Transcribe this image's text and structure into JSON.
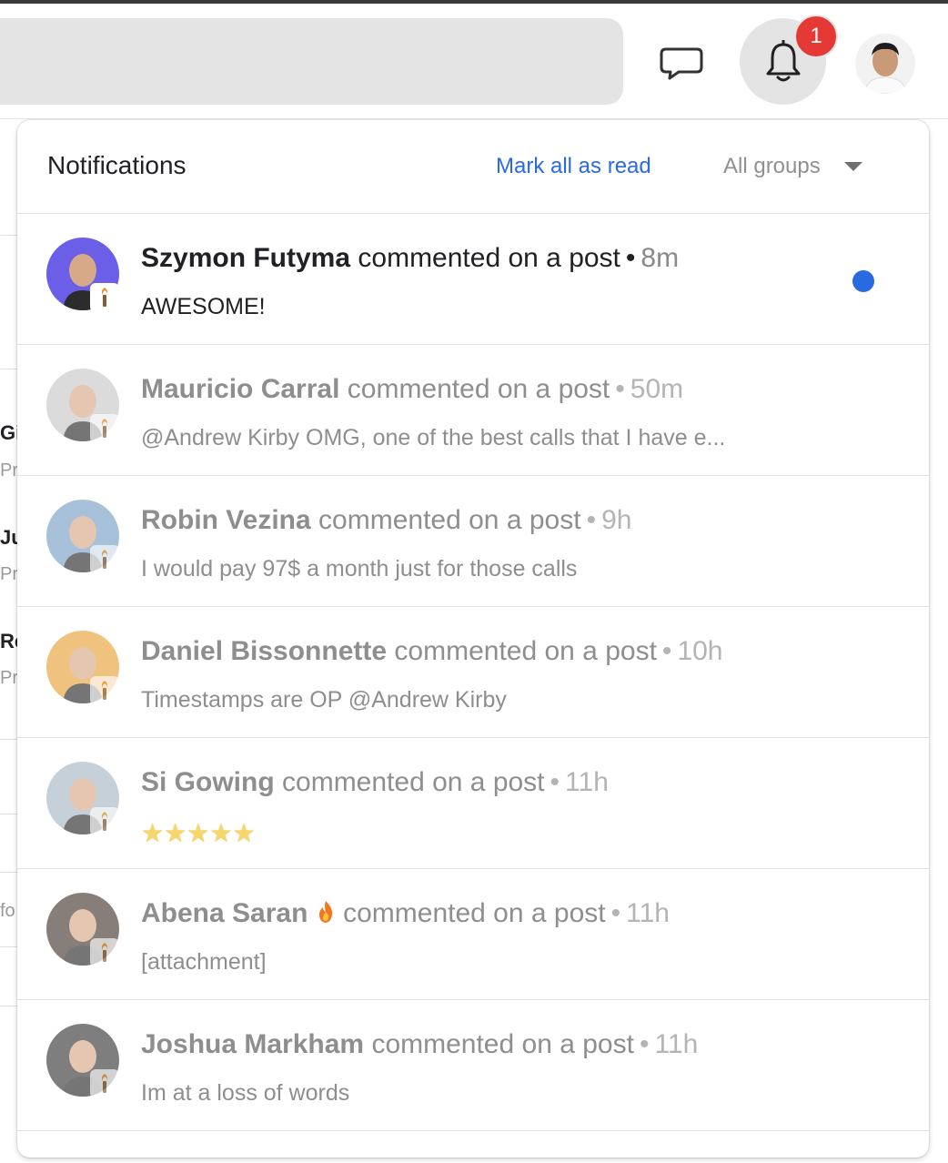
{
  "header": {
    "badge_count": "1"
  },
  "background": {
    "fragments": [
      "Gi",
      "Pr",
      "Ju",
      "Pr",
      "Re",
      "Pr",
      "fo"
    ]
  },
  "panel": {
    "title": "Notifications",
    "mark_all_label": "Mark all as read",
    "group_filter_label": "All groups"
  },
  "notifications": [
    {
      "name": "Szymon Futyma",
      "action": "commented on a post",
      "time": "8m",
      "text": "AWESOME!",
      "unread": true,
      "avatar_color": "#6b5fe8"
    },
    {
      "name": "Mauricio Carral",
      "action": "commented on a post",
      "time": "50m",
      "text": "@Andrew Kirby OMG, one of the best calls that I have e...",
      "unread": false,
      "avatar_color": "#c8c8c8"
    },
    {
      "name": "Robin Vezina",
      "action": "commented on a post",
      "time": "9h",
      "text": "I would pay 97$ a month just for those calls",
      "unread": false,
      "avatar_color": "#7aa0c8"
    },
    {
      "name": "Daniel Bissonnette",
      "action": "commented on a post",
      "time": "10h",
      "text": "Timestamps are OP @Andrew Kirby",
      "unread": false,
      "avatar_color": "#e8a33a"
    },
    {
      "name": "Si Gowing",
      "action": "commented on a post",
      "time": "11h",
      "text": "",
      "unread": false,
      "avatar_color": "#a9b8c4"
    },
    {
      "name": "Abena Saran",
      "action": "commented on a post",
      "time": "11h",
      "text": "[attachment]",
      "unread": false,
      "avatar_color": "#4a3a32"
    },
    {
      "name": "Joshua Markham",
      "action": "commented on a post",
      "time": "11h",
      "text": "Im at a loss of words",
      "unread": false,
      "avatar_color": "#3a3a3a"
    }
  ],
  "icons": {
    "chat": "chat-bubble-icon",
    "bell": "bell-icon",
    "torch": "torch-icon",
    "fire": "fire-icon",
    "star": "star-icon"
  },
  "colors": {
    "accent": "#2a6ae0",
    "badge": "#e53935"
  }
}
